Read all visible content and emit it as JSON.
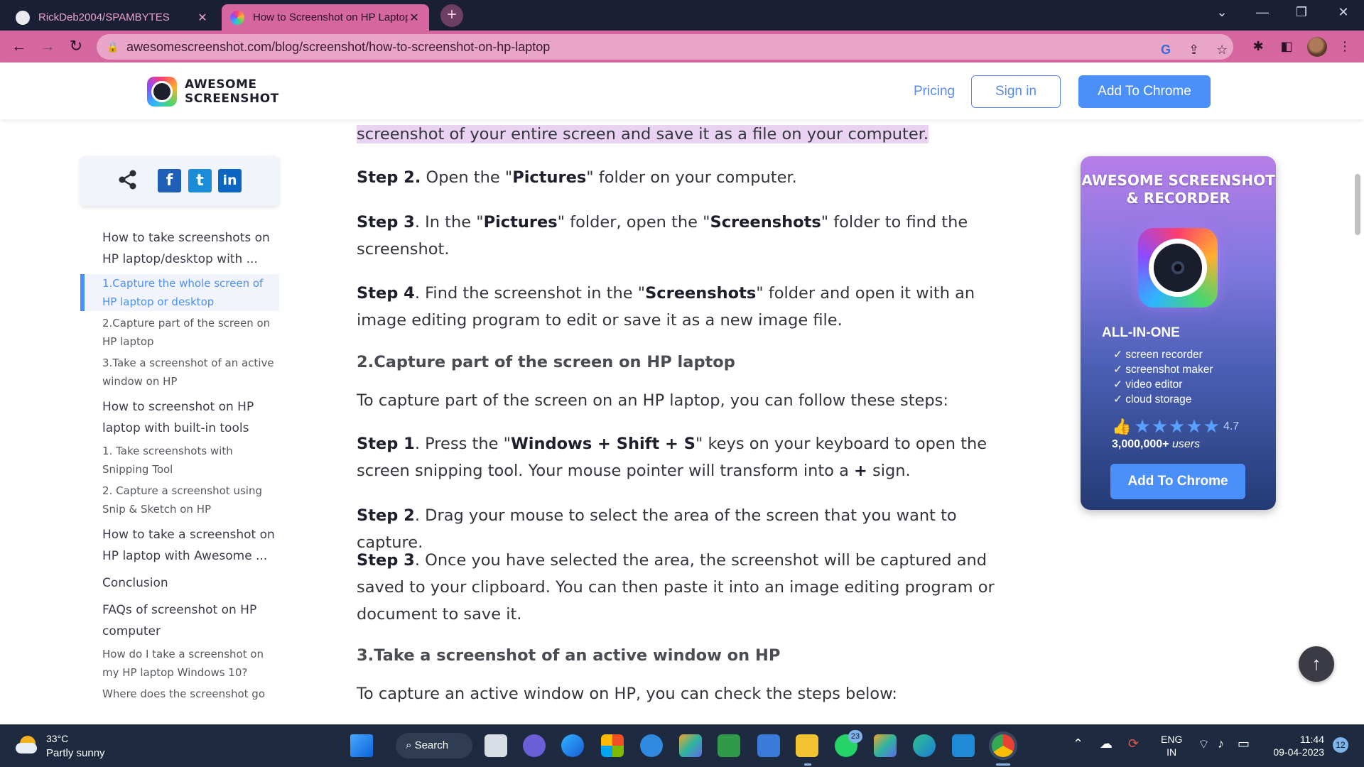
{
  "browser": {
    "tabs": [
      {
        "title": "RickDeb2004/SPAMBYTES",
        "close": "✕"
      },
      {
        "title": "How to Screenshot on HP Laptop",
        "close": "✕"
      }
    ],
    "new_tab": "+",
    "url": "awesomescreenshot.com/blog/screenshot/how-to-screenshot-on-hp-laptop"
  },
  "header": {
    "logo_line1": "AWESOME",
    "logo_line2": "SCREENSHOT",
    "pricing": "Pricing",
    "signin": "Sign in",
    "add_to_chrome": "Add To Chrome"
  },
  "toc": [
    {
      "text": "How to take screenshots on HP laptop/desktop with ...",
      "level": "h"
    },
    {
      "text": "1.Capture the whole screen of HP laptop or desktop",
      "level": "s",
      "active": true
    },
    {
      "text": "2.Capture part of the screen on HP laptop",
      "level": "s"
    },
    {
      "text": "3.Take a screenshot of an active window on HP",
      "level": "s"
    },
    {
      "text": "How to screenshot on HP laptop with built-in tools",
      "level": "h"
    },
    {
      "text": "1. Take screenshots with Snipping Tool",
      "level": "s"
    },
    {
      "text": "2. Capture a screenshot using Snip & Sketch on HP",
      "level": "s"
    },
    {
      "text": "How to take a screenshot on HP laptop with Awesome ...",
      "level": "h"
    },
    {
      "text": "Conclusion",
      "level": "h"
    },
    {
      "text": "FAQs of screenshot on HP computer",
      "level": "h"
    },
    {
      "text": "How do I take a screenshot on my HP laptop Windows 10?",
      "level": "s"
    },
    {
      "text": "Where does the screenshot go on HP laptop?",
      "level": "s"
    }
  ],
  "article": {
    "top_line": "screenshot of your entire screen and save it as a file on your computer.",
    "s2_label": "Step 2.",
    "s2_a": " Open the \"",
    "s2_b": "Pictures",
    "s2_c": "\" folder on your computer.",
    "s3_label": "Step 3",
    "s3_a": ". In the \"",
    "s3_b": "Pictures",
    "s3_c": "\" folder, open the \"",
    "s3_d": "Screenshots",
    "s3_e": "\" folder to find the screenshot.",
    "s4_label": "Step 4",
    "s4_a": ". Find the screenshot in the \"",
    "s4_b": "Screenshots",
    "s4_c": "\" folder and open it with an image editing program to edit or save it as a new image file.",
    "h_capture_part": "2.Capture part of the screen on HP laptop",
    "intro_part": "To capture part of the screen on an HP laptop, you can follow these steps:",
    "p1_label": "Step 1",
    "p1_a": ". Press the \"",
    "p1_b": "Windows + Shift + S",
    "p1_c": "\" keys on your keyboard to open the screen snipping tool. Your mouse pointer will transform into a ",
    "p1_d": "+",
    "p1_e": " sign.",
    "p2_label": "Step 2",
    "p2_a": ". Drag your mouse to select the area of the screen that you want to capture.",
    "p3_label": "Step 3",
    "p3_a": ". Once you have selected the area, the screenshot will be captured and saved to your clipboard. You can then paste it into an image editing program or document to save it.",
    "h_active_window": "3.Take a screenshot of an active window on HP",
    "intro_active": "To capture an active window on HP, you can check the steps below:"
  },
  "promo": {
    "title_line1": "AWESOME SCREENSHOT",
    "title_line2": "& RECORDER",
    "all_in_one": "ALL-IN-ONE",
    "features": [
      "screen recorder",
      "screenshot maker",
      "video editor",
      "cloud storage"
    ],
    "rating": 4.7,
    "stars": "★★★★★",
    "users_count": "3,000,000+",
    "users_label": "users",
    "button": "Add To Chrome"
  },
  "taskbar": {
    "temperature": "33°C",
    "condition": "Partly sunny",
    "search": "Search",
    "whatsapp_badge": "23",
    "language_line1": "ENG",
    "language_line2": "IN",
    "time": "11:44",
    "date": "09-04-2023",
    "notifications": "12"
  }
}
